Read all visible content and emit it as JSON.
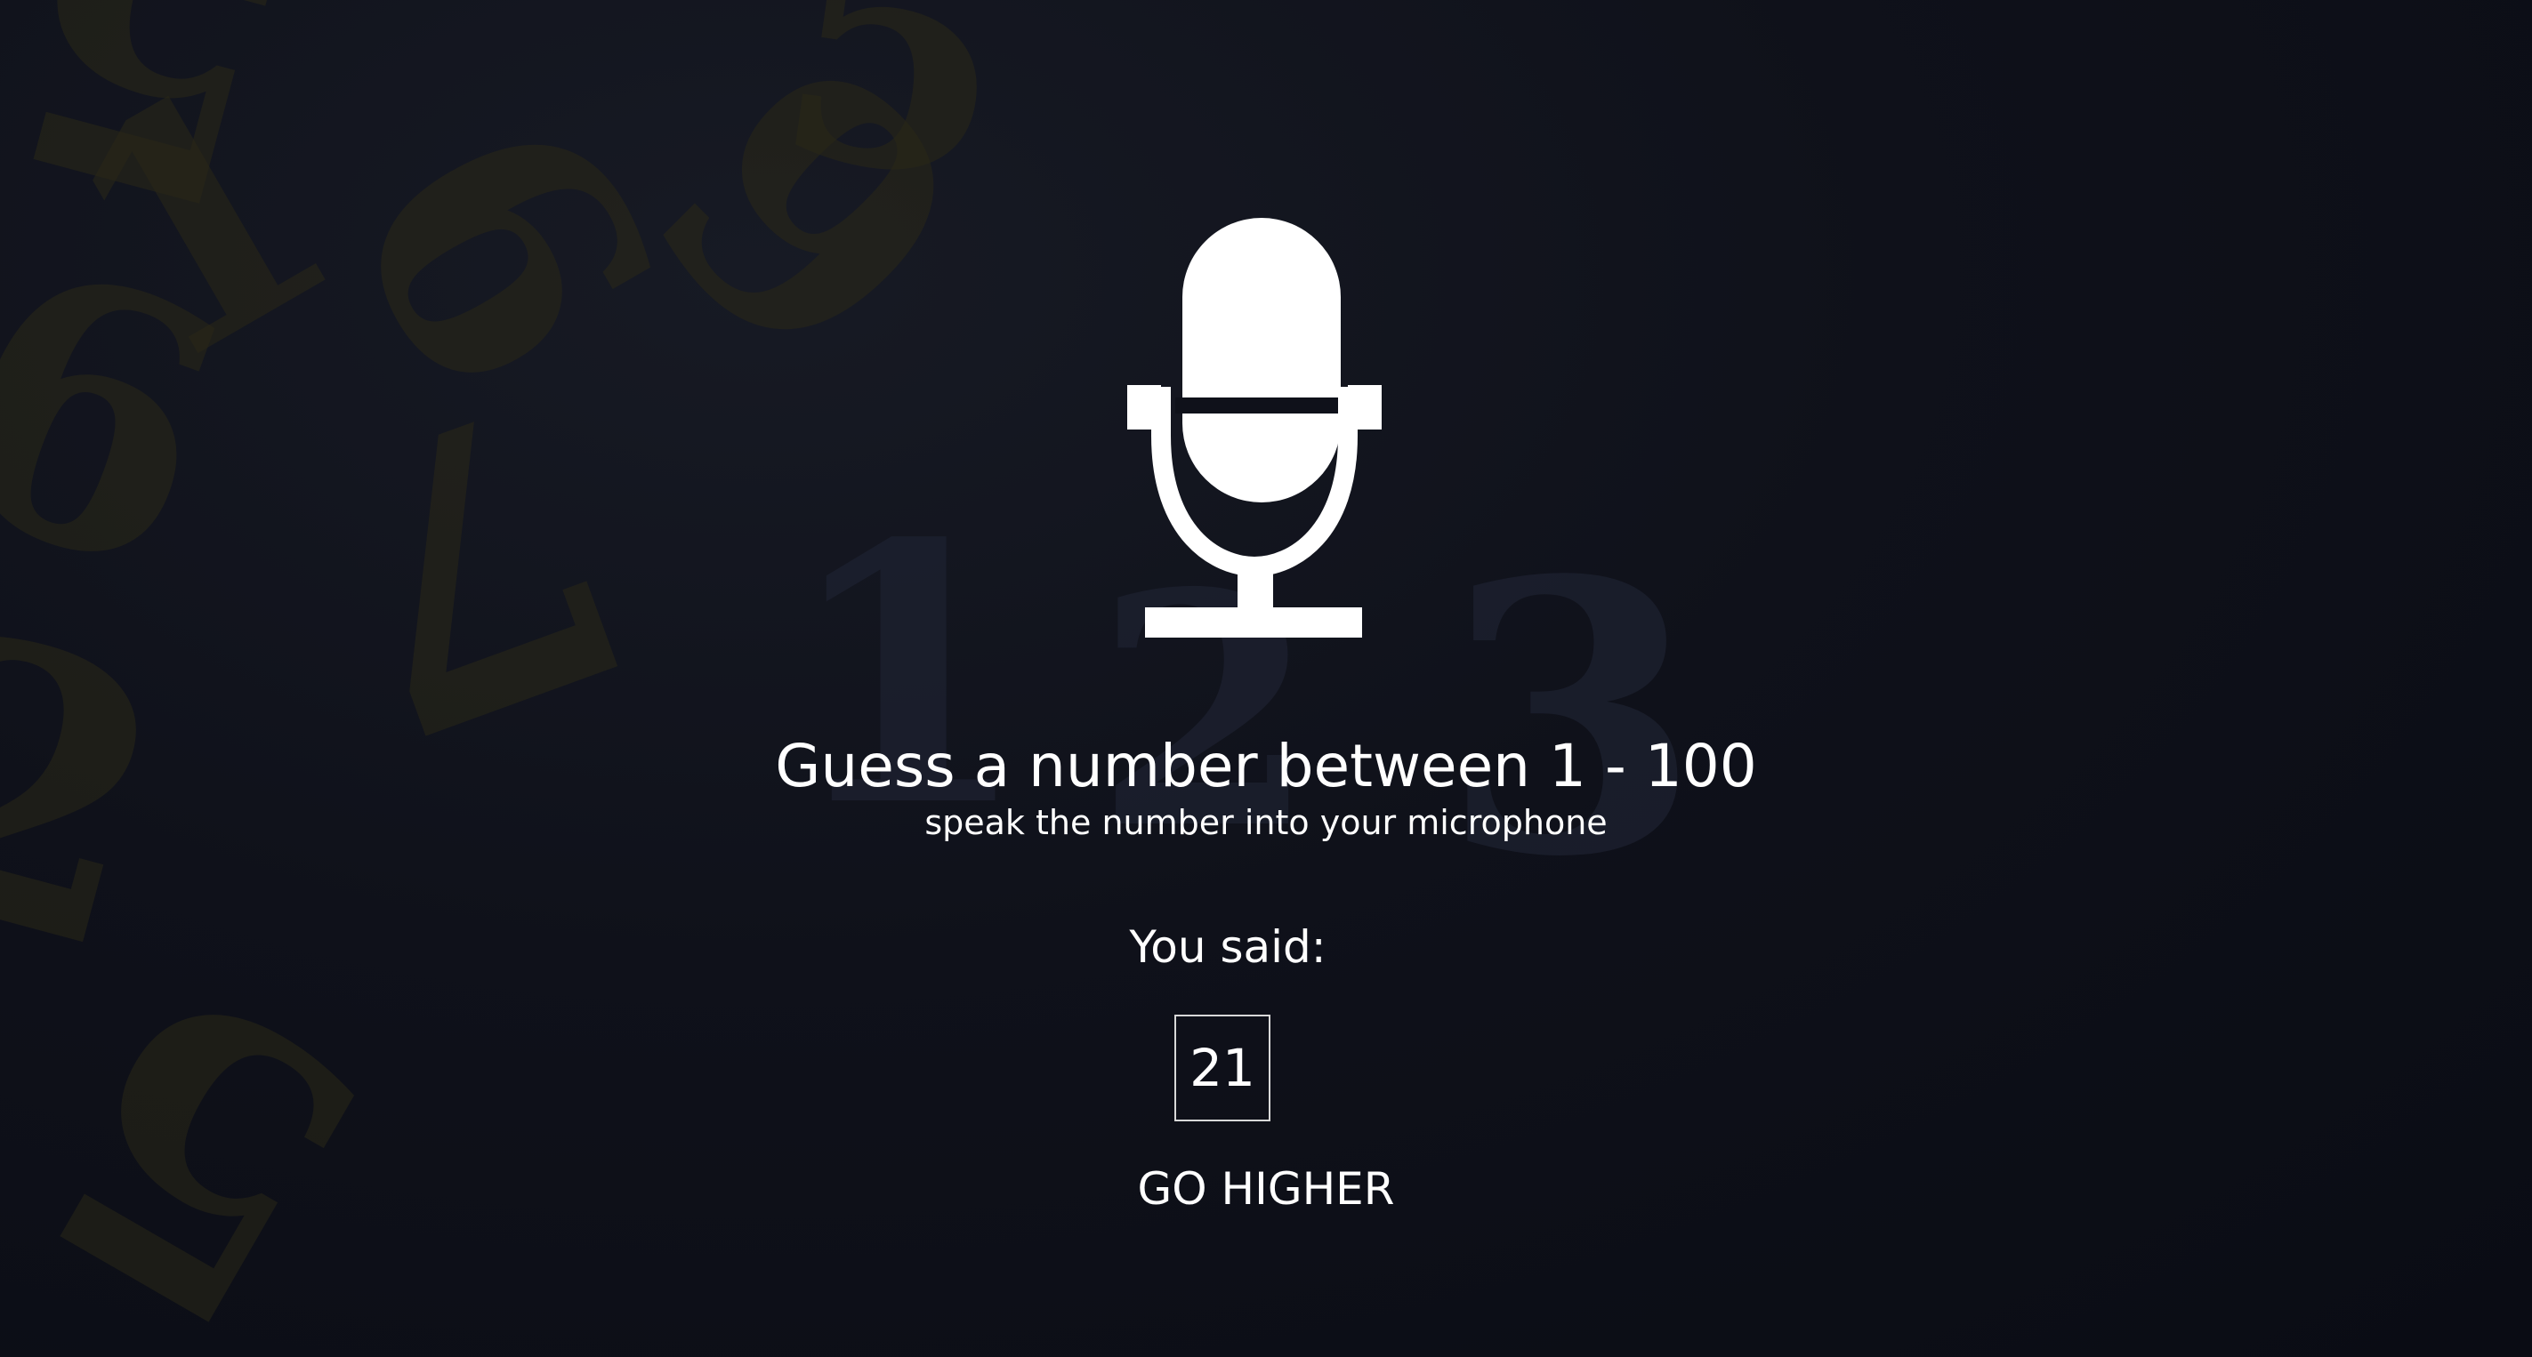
{
  "background": {
    "digits": [
      "5",
      "5",
      "1",
      "9",
      "6",
      "9",
      "2",
      "5",
      "7",
      "1",
      "2",
      "3"
    ]
  },
  "prompt": {
    "title": "Guess a number between 1 - 100",
    "instruction": "speak the number into your microphone"
  },
  "result": {
    "label": "You said:",
    "number": "21",
    "hint": "GO HIGHER"
  },
  "icons": {
    "microphone": "microphone-icon"
  },
  "colors": {
    "background": "#0f111a",
    "text": "#ffffff",
    "box_border": "#d8d8d8"
  }
}
